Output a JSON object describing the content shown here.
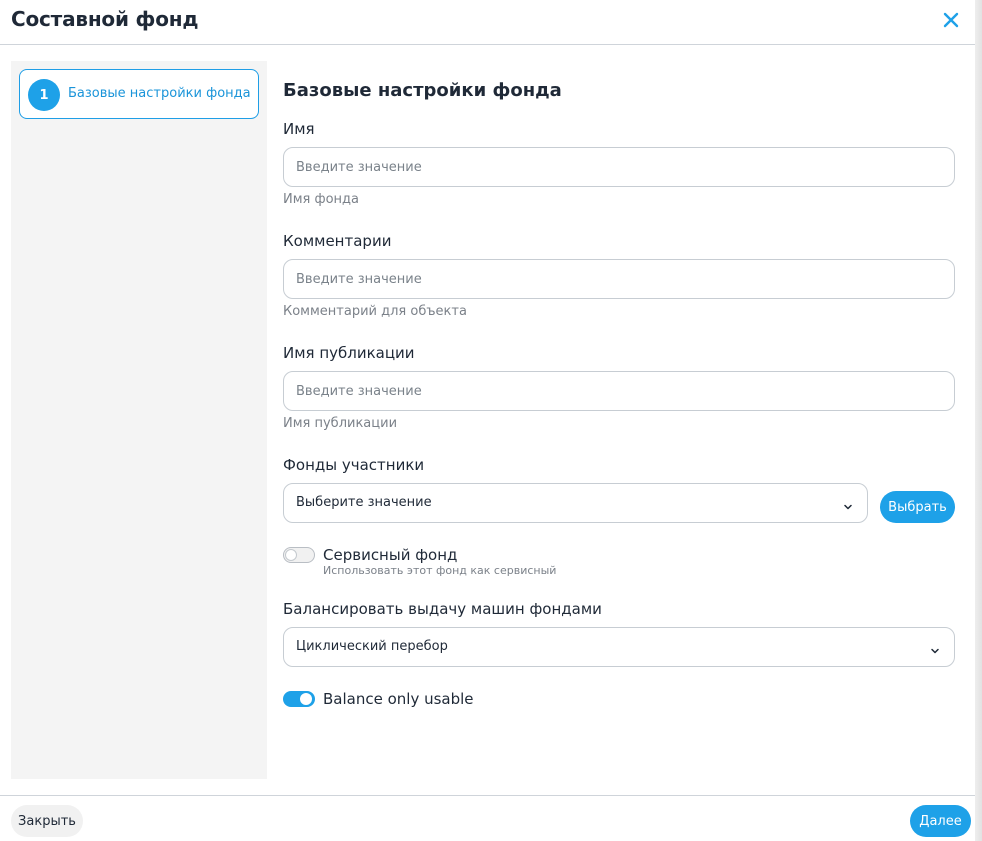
{
  "dialog": {
    "title": "Составной фонд",
    "close_icon": "close-icon",
    "accent_color": "#1ea1e8"
  },
  "stepper": {
    "steps": [
      {
        "number": "1",
        "label": "Базовые настройки фонда",
        "active": true
      }
    ]
  },
  "form": {
    "section_title": "Базовые настройки фонда",
    "name": {
      "label": "Имя",
      "placeholder": "Введите значение",
      "value": "",
      "hint": "Имя фонда"
    },
    "comment": {
      "label": "Комментарии",
      "placeholder": "Введите значение",
      "value": "",
      "hint": "Комментарий для объекта"
    },
    "publication_name": {
      "label": "Имя публикации",
      "placeholder": "Введите значение",
      "value": "",
      "hint": "Имя публикации"
    },
    "member_pools": {
      "label": "Фонды участники",
      "selected": "Выберите значение",
      "pick_button": "Выбрать"
    },
    "service_pool": {
      "label": "Сервисный фонд",
      "description": "Использовать этот фонд как сервисный",
      "enabled": false
    },
    "balancing": {
      "label": "Балансировать выдачу машин фондами",
      "selected": "Циклический перебор"
    },
    "balance_only_usable": {
      "label": "Balance only usable",
      "enabled": true
    }
  },
  "footer": {
    "close_label": "Закрыть",
    "next_label": "Далее"
  }
}
